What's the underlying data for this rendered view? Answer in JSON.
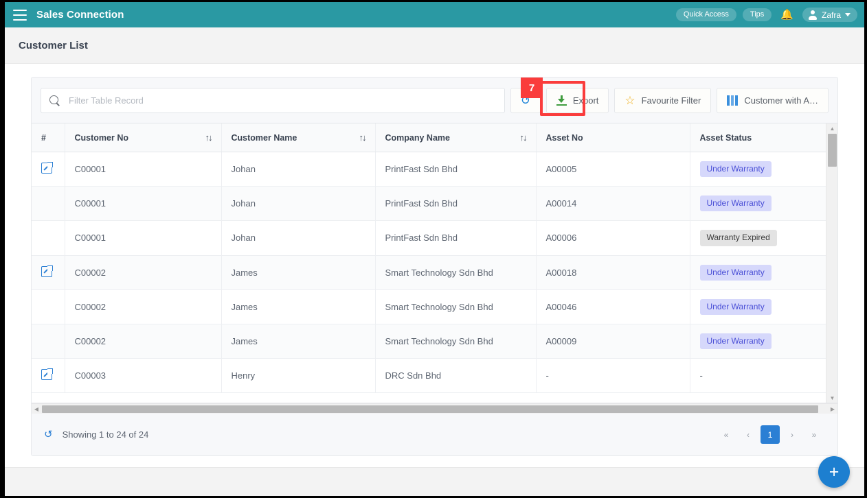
{
  "topnav": {
    "menu_icon": "hamburger-icon",
    "brand": "Sales Connection",
    "quick_access": "Quick Access",
    "tips": "Tips",
    "bell_icon": "bell-icon",
    "user_name": "Zafra"
  },
  "page": {
    "title": "Customer List"
  },
  "toolbar": {
    "search_placeholder": "Filter Table Record",
    "search_value": "",
    "refresh_label": "",
    "export_label": "Export",
    "favourite_filter_label": "Favourite Filter",
    "columns_label": "Customer with A…"
  },
  "annotation": {
    "step_number": "7",
    "color": "#fa3c3c"
  },
  "table": {
    "columns": [
      {
        "label": "#",
        "sortable": false
      },
      {
        "label": "Customer No",
        "sortable": true
      },
      {
        "label": "Customer Name",
        "sortable": true
      },
      {
        "label": "Company Name",
        "sortable": true
      },
      {
        "label": "Asset No",
        "sortable": false
      },
      {
        "label": "Asset Status",
        "sortable": false
      }
    ],
    "sort_icon": "sort-updown-icon",
    "open_icon": "open-external-icon",
    "rows": [
      {
        "has_open": true,
        "customer_no": "C00001",
        "customer_name": "Johan",
        "company_name": "PrintFast Sdn Bhd",
        "asset_no": "A00005",
        "asset_status": "Under Warranty",
        "status_kind": "warranty"
      },
      {
        "has_open": false,
        "customer_no": "C00001",
        "customer_name": "Johan",
        "company_name": "PrintFast Sdn Bhd",
        "asset_no": "A00014",
        "asset_status": "Under Warranty",
        "status_kind": "warranty"
      },
      {
        "has_open": false,
        "customer_no": "C00001",
        "customer_name": "Johan",
        "company_name": "PrintFast Sdn Bhd",
        "asset_no": "A00006",
        "asset_status": "Warranty Expired",
        "status_kind": "expired"
      },
      {
        "has_open": true,
        "customer_no": "C00002",
        "customer_name": "James",
        "company_name": "Smart Technology Sdn Bhd",
        "asset_no": "A00018",
        "asset_status": "Under Warranty",
        "status_kind": "warranty"
      },
      {
        "has_open": false,
        "customer_no": "C00002",
        "customer_name": "James",
        "company_name": "Smart Technology Sdn Bhd",
        "asset_no": "A00046",
        "asset_status": "Under Warranty",
        "status_kind": "warranty"
      },
      {
        "has_open": false,
        "customer_no": "C00002",
        "customer_name": "James",
        "company_name": "Smart Technology Sdn Bhd",
        "asset_no": "A00009",
        "asset_status": "Under Warranty",
        "status_kind": "warranty"
      },
      {
        "has_open": true,
        "customer_no": "C00003",
        "customer_name": "Henry",
        "company_name": "DRC Sdn Bhd",
        "asset_no": "-",
        "asset_status": "-",
        "status_kind": "none"
      }
    ]
  },
  "footer": {
    "refresh_icon": "refresh-icon",
    "showing_text": "Showing 1 to 24 of 24",
    "pagination": {
      "first": "«",
      "prev": "‹",
      "pages": [
        "1"
      ],
      "current": "1",
      "next": "›",
      "last": "»"
    }
  },
  "fab": {
    "label": "+"
  },
  "colors": {
    "brand_teal": "#2a99a3",
    "accent_blue": "#2b7fd4",
    "badge_warranty_bg": "#d6d8fb",
    "badge_warranty_text": "#4a4fd6",
    "badge_expired_bg": "#e3e3e3",
    "annotation_red": "#fa3c3c"
  }
}
